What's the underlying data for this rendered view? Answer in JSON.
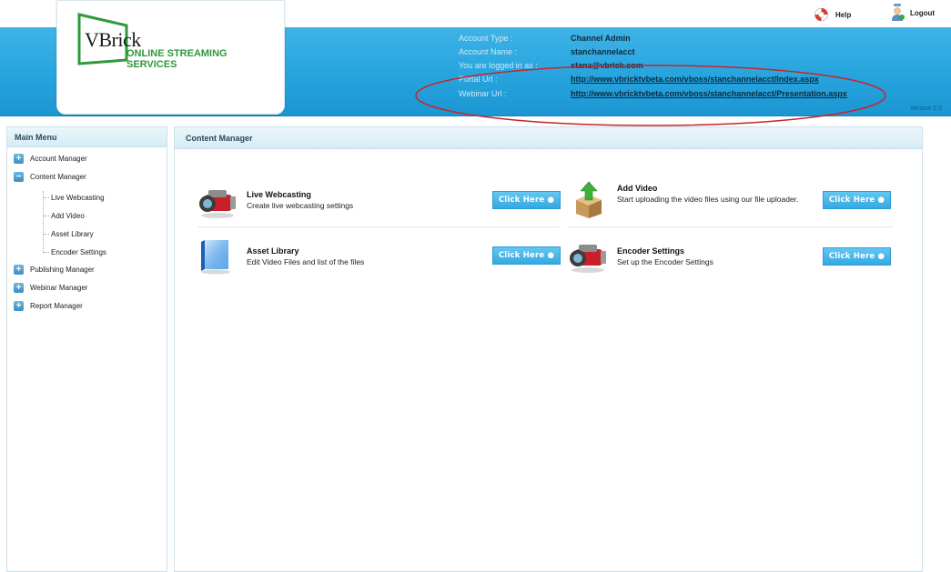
{
  "topbar": {
    "help_label": "Help",
    "logout_label": "Logout"
  },
  "logo": {
    "brand": "VBrick",
    "line1": "ONLINE STREAMING",
    "line2": "SERVICES"
  },
  "account": {
    "type_label": "Account Type :",
    "type_value": "Channel Admin",
    "name_label": "Account Name :",
    "name_value": "stanchannelacct",
    "logged_label": "You are logged in as :",
    "logged_value": "stana@vbrick.com",
    "portal_label": "Portal Url :",
    "portal_value": "http://www.vbricktvbeta.com/vboss/stanchannelacct/Index.aspx",
    "webinar_label": "Webinar Url :",
    "webinar_value": "http://www.vbricktvbeta.com/vboss/stanchannelacct/Presentation.aspx"
  },
  "version": "Version 2.0",
  "menu": {
    "title": "Main Menu",
    "items": [
      {
        "label": "Account Manager",
        "expand": "+"
      },
      {
        "label": "Content Manager",
        "expand": "−"
      },
      {
        "label": "Publishing Manager",
        "expand": "+"
      },
      {
        "label": "Webinar Manager",
        "expand": "+"
      },
      {
        "label": "Report Manager",
        "expand": "+"
      }
    ],
    "subitems": [
      "Live Webcasting",
      "Add Video",
      "Asset Library",
      "Encoder Settings"
    ]
  },
  "content": {
    "title": "Content Manager",
    "button_label": "Click Here ●",
    "cards": [
      {
        "title": "Live Webcasting",
        "desc": "Create live webcasting settings",
        "icon": "video-camera-icon"
      },
      {
        "title": "Add Video",
        "desc": "Start uploading the video files using our file uploader.",
        "icon": "upload-box-icon"
      },
      {
        "title": "Asset Library",
        "desc": "Edit Video Files and list of the files",
        "icon": "asset-library-icon"
      },
      {
        "title": "Encoder Settings",
        "desc": "Set up the Encoder Settings",
        "icon": "video-camera-icon"
      }
    ]
  },
  "colors": {
    "header_blue": "#27a4de",
    "button_blue": "#4bb8ea",
    "logo_green": "#2e9a3c",
    "annotation_red": "#c8242a"
  }
}
